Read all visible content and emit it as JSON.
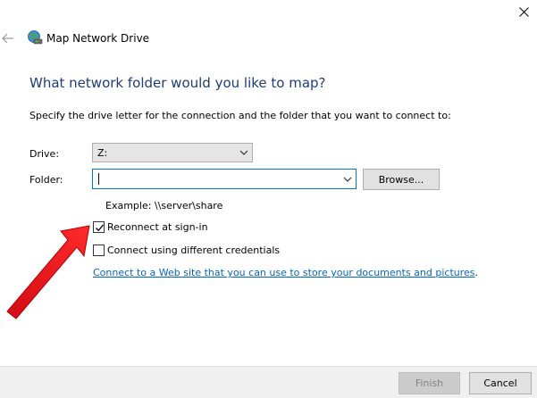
{
  "window": {
    "title": "Map Network Drive",
    "icons": {
      "close": "close-icon",
      "back": "back-arrow-icon",
      "app": "network-drive-icon"
    }
  },
  "main": {
    "heading": "What network folder would you like to map?",
    "instructions": "Specify the drive letter for the connection and the folder that you want to connect to:",
    "drive": {
      "label": "Drive:",
      "selected": "Z:"
    },
    "folder": {
      "label": "Folder:",
      "value": ""
    },
    "browse_label": "Browse...",
    "example": "Example: \\\\server\\share",
    "reconnect": {
      "label": "Reconnect at sign-in",
      "checked": true
    },
    "credentials": {
      "label": "Connect using different credentials",
      "checked": false
    },
    "web_link": "Connect to a Web site that you can use to store your documents and pictures",
    "web_link_suffix": "."
  },
  "footer": {
    "finish_label": "Finish",
    "cancel_label": "Cancel"
  },
  "colors": {
    "heading": "#1e3c78",
    "link": "#0066cc",
    "focus_border": "#0078d7",
    "annotation_arrow": "#e8131b"
  }
}
